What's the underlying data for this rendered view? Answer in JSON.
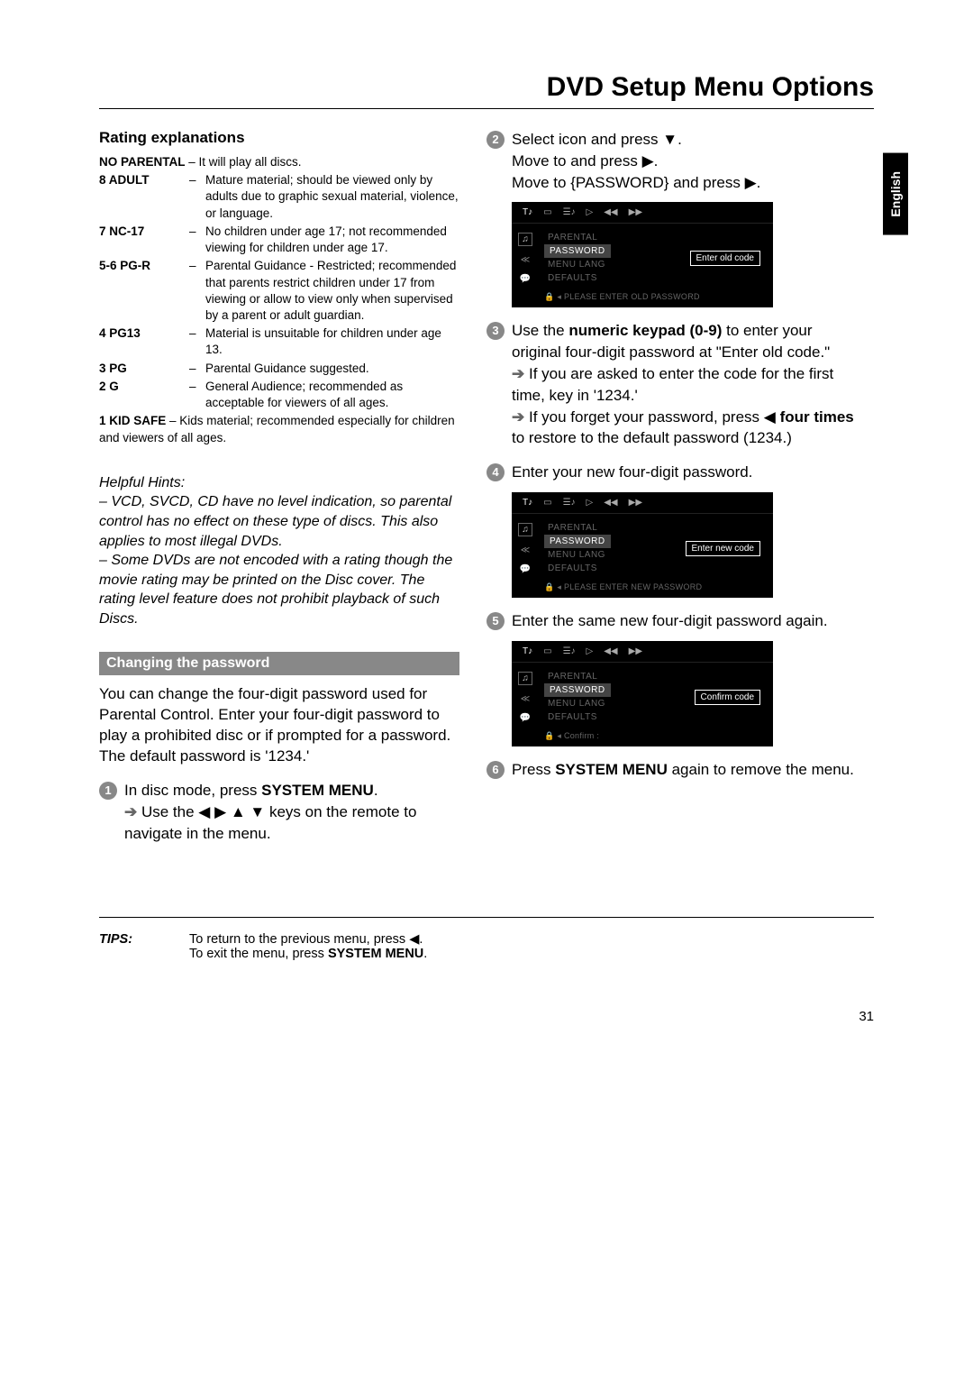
{
  "page_title": "DVD Setup Menu Options",
  "lang_tab": "English",
  "page_number": "31",
  "section_rating": "Rating explanations",
  "ratings": [
    {
      "label": "NO PARENTAL",
      "text": "It will play all discs.",
      "inline": true
    },
    {
      "label": "8 ADULT",
      "text": "Mature material; should be viewed only by adults due to graphic sexual material, violence, or language."
    },
    {
      "label": "7 NC-17",
      "text": "No children under age 17; not recommended viewing for children under age 17."
    },
    {
      "label": "5-6 PG-R",
      "text": "Parental Guidance - Restricted; recommended that parents restrict children under 17 from viewing or allow to view only when supervised by a parent or adult guardian."
    },
    {
      "label": "4 PG13",
      "text": "Material is unsuitable for children under age 13."
    },
    {
      "label": "3 PG",
      "text": "Parental Guidance suggested."
    },
    {
      "label": "2 G",
      "text": "General Audience; recommended as acceptable for viewers of all ages."
    },
    {
      "label": "1 KID SAFE",
      "text": "Kids material; recommended especially for children and viewers of all ages.",
      "inline": true
    }
  ],
  "hints_title": "Helpful Hints:",
  "hints_1": "–  VCD, SVCD, CD have no level indication, so parental control has no effect on these type of discs. This also applies to most illegal DVDs.",
  "hints_2": "–  Some DVDs are not encoded with a rating though the movie rating may be printed on the Disc cover.  The rating level feature does not prohibit playback of such Discs.",
  "banner_changing": "Changing the password",
  "changing_intro": "You can change the four-digit password used for Parental Control.  Enter your four-digit password to play a prohibited disc or if prompted for a password.  The default password is '1234.'",
  "step1_a": "In disc mode, press ",
  "step1_b": "SYSTEM MENU",
  "step1_c": ".",
  "step1_sub": "Use the ◀ ▶ ▲ ▼ keys on the remote to navigate in the menu.",
  "step2_a": "Select       icon and press ▼.",
  "step2_b": "Move to        and press ▶.",
  "step2_c": "Move to {PASSWORD} and press ▶.",
  "step3_a": "Use the ",
  "step3_b": "numeric keypad (0-9)",
  "step3_c": " to enter your original four-digit password at \"Enter old code.\"",
  "step3_sub1": "If you are asked to enter the code for the first time, key in '1234.'",
  "step3_sub2_a": "If you forget your password, press ◀ ",
  "step3_sub2_b": "four times",
  "step3_sub2_c": " to restore to the default password (1234.)",
  "step4": "Enter your new four-digit password.",
  "step5": "Enter the same new four-digit password again.",
  "step6_a": "Press ",
  "step6_b": "SYSTEM MENU",
  "step6_c": " again to remove the menu.",
  "osd": {
    "topicons": [
      "T♪",
      "▭",
      "☰♪",
      "▷",
      "◀◀",
      "▶▶"
    ],
    "side": [
      "♫",
      "≪",
      "💬"
    ],
    "items": [
      "PARENTAL",
      "PASSWORD",
      "MENU LANG",
      "DEFAULTS"
    ],
    "box1": "Enter old code",
    "footer1": "PLEASE ENTER OLD PASSWORD",
    "box2": "Enter new code",
    "footer2": "PLEASE ENTER NEW PASSWORD",
    "box3": "Confirm code",
    "footer3": "Confirm :"
  },
  "tips_label": "TIPS:",
  "tips_line1": "To return to the previous menu, press ◀.",
  "tips_line2_a": "To exit the menu, press ",
  "tips_line2_b": "SYSTEM MENU",
  "tips_line2_c": "."
}
